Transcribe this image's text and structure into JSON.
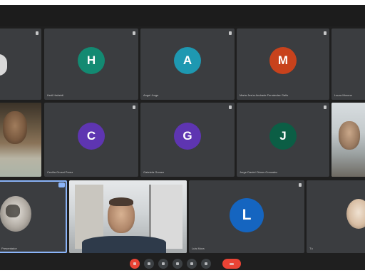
{
  "participants": [
    {
      "name": "",
      "initial": "",
      "color": "#9e9e9e"
    },
    {
      "name": "Hedi Hafreidi",
      "initial": "H",
      "color": "#138a72"
    },
    {
      "name": "Angel Jorge",
      "initial": "A",
      "color": "#1e98b1"
    },
    {
      "name": "Maria Jesús Andrade Fernández Gallo",
      "initial": "M",
      "color": "#c8421c"
    },
    {
      "name": "Laura Moreno",
      "initial": "",
      "color": "#3b3d40"
    },
    {
      "name": "",
      "initial": "",
      "color": ""
    },
    {
      "name": "Cecilia Grossi Perez",
      "initial": "C",
      "color": "#5e35b1"
    },
    {
      "name": "Gabriela Gomez",
      "initial": "G",
      "color": "#5e35b1"
    },
    {
      "name": "Jorge Daniel Olmos Gonzalez",
      "initial": "J",
      "color": "#0b5e45"
    },
    {
      "name": "",
      "initial": "",
      "color": ""
    },
    {
      "name": "Presentador",
      "initial": "",
      "color": ""
    },
    {
      "name": "",
      "initial": "",
      "color": ""
    },
    {
      "name": "Luis Mora",
      "initial": "L",
      "color": "#1565c0"
    },
    {
      "name": "Tú",
      "initial": "",
      "color": ""
    }
  ],
  "controls": [
    {
      "name": "mic-off-button",
      "color": "#ea4335"
    },
    {
      "name": "camera-button",
      "color": "#3c4043"
    },
    {
      "name": "captions-button",
      "color": "#3c4043"
    },
    {
      "name": "raise-hand-button",
      "color": "#3c4043"
    },
    {
      "name": "present-button",
      "color": "#3c4043"
    },
    {
      "name": "more-options-button",
      "color": "#3c4043"
    },
    {
      "name": "end-call-button",
      "color": "#ea4335"
    }
  ]
}
